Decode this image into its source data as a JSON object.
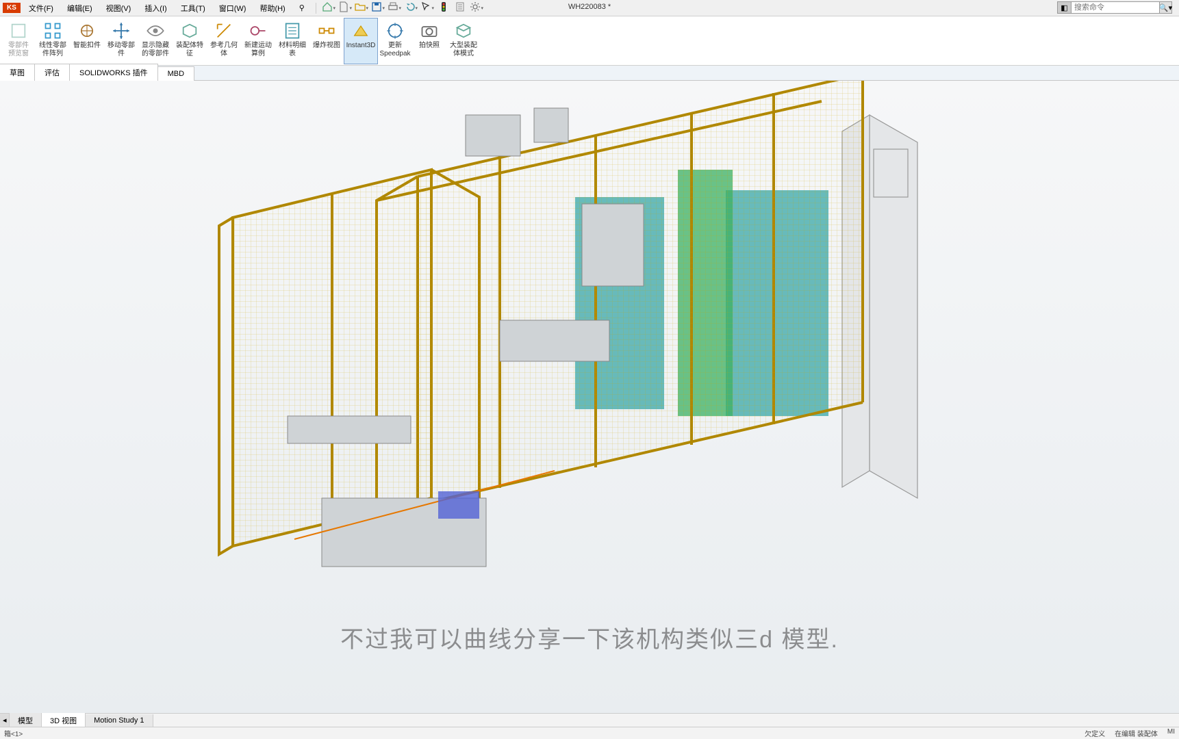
{
  "app": {
    "badge": "KS",
    "doc_title": "WH220083 *"
  },
  "menu": {
    "file": "文件(F)",
    "edit": "编辑(E)",
    "view": "视图(V)",
    "insert": "插入(I)",
    "tools": "工具(T)",
    "window": "窗口(W)",
    "help": "帮助(H)",
    "pin": "⚲"
  },
  "quick": {
    "home": "home-icon",
    "new": "new-icon",
    "open": "open-icon",
    "save": "save-icon",
    "print": "print-icon",
    "undo": "undo-icon",
    "select": "select-icon",
    "rebuild": "rebuild-icon",
    "options": "options-icon",
    "settings": "settings-icon"
  },
  "search": {
    "placeholder": "搜索命令",
    "glass": "🔍"
  },
  "ribbon": [
    {
      "id": "insert-components",
      "label": "零部件\n预览窗",
      "icon": "component-icon",
      "disabled": true
    },
    {
      "id": "linear-pattern",
      "label": "线性零部件阵列",
      "icon": "pattern-icon"
    },
    {
      "id": "smart-fasteners",
      "label": "智能扣件",
      "icon": "fastener-icon"
    },
    {
      "id": "move-component",
      "label": "移动零部件",
      "icon": "move-icon"
    },
    {
      "id": "show-hidden",
      "label": "显示隐藏的零部件",
      "icon": "visibility-icon"
    },
    {
      "id": "assembly-features",
      "label": "装配体特征",
      "icon": "feature-icon"
    },
    {
      "id": "reference-geometry",
      "label": "参考几何体",
      "icon": "refgeom-icon"
    },
    {
      "id": "new-motion-study",
      "label": "新建运动算例",
      "icon": "motion-icon"
    },
    {
      "id": "bom",
      "label": "材料明细表",
      "icon": "bom-icon"
    },
    {
      "id": "exploded-view",
      "label": "爆炸视图",
      "icon": "exploded-icon"
    },
    {
      "id": "instant3d",
      "label": "Instant3D",
      "icon": "instant3d-icon",
      "active": true
    },
    {
      "id": "update-speedpak",
      "label": "更新\nSpeedpak",
      "icon": "speedpak-icon"
    },
    {
      "id": "take-snapshot",
      "label": "拍快照",
      "icon": "snapshot-icon"
    },
    {
      "id": "large-assembly",
      "label": "大型装配体模式",
      "icon": "largeasm-icon"
    }
  ],
  "cm_tabs": [
    {
      "id": "sketch",
      "label": "草图"
    },
    {
      "id": "evaluate",
      "label": "评估"
    },
    {
      "id": "plugins",
      "label": "SOLIDWORKS 插件"
    },
    {
      "id": "mbd",
      "label": "MBD"
    }
  ],
  "view_tabs": [
    {
      "id": "model",
      "label": "模型"
    },
    {
      "id": "3dview",
      "label": "3D 视图",
      "active": true
    },
    {
      "id": "motion",
      "label": "Motion Study 1"
    }
  ],
  "status": {
    "left": "箱<1>",
    "right": [
      "欠定义",
      "在编辑 装配体",
      "MI"
    ]
  },
  "subtitle": "不过我可以曲线分享一下该机构类似三d 模型.",
  "colors": {
    "accent": "#d6e9f8",
    "frame": "#b08700",
    "teal": "#3aa7a7",
    "green": "#3cb061"
  }
}
